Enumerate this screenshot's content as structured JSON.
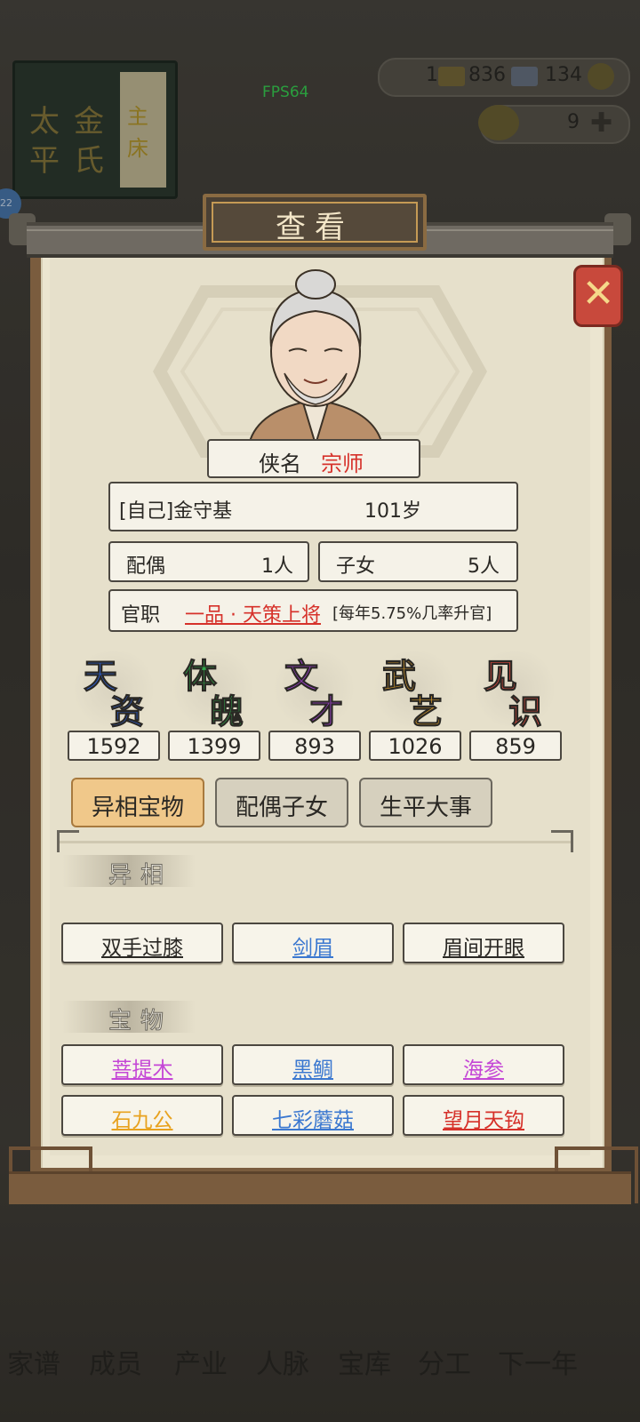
{
  "fps": "FPS64",
  "book_chars": [
    "太",
    "平",
    "金",
    "氏",
    "主",
    "床"
  ],
  "level_badge": "22",
  "resources": {
    "r1": "1",
    "r2": "836",
    "r3": "134",
    "r4": "9"
  },
  "bottom_nav": [
    "家谱",
    "成员",
    "产业",
    "人脉",
    "宝库",
    "分工",
    "下一年"
  ],
  "dialog": {
    "title": "查看",
    "close_icon": "close-icon",
    "nickname_label": "侠名",
    "nickname_value": "宗师",
    "name": "[自己]金守基",
    "age": "101岁",
    "spouse_label": "配偶",
    "spouse_value": "1人",
    "children_label": "子女",
    "children_value": "5人",
    "office_label": "官职",
    "office_value": "一品 · 天策上将",
    "office_note": "[每年5.75%几率升官]",
    "attributes": [
      {
        "c1": "天",
        "c2": "资",
        "value": "1592",
        "color": "#2c5fd6"
      },
      {
        "c1": "体",
        "c2": "魄",
        "value": "1399",
        "color": "#2fa84a"
      },
      {
        "c1": "文",
        "c2": "才",
        "value": "893",
        "color": "#9a3fc9"
      },
      {
        "c1": "武",
        "c2": "艺",
        "value": "1026",
        "color": "#e0a12b"
      },
      {
        "c1": "见",
        "c2": "识",
        "value": "859",
        "color": "#d9483d"
      }
    ],
    "tabs": [
      "异相宝物",
      "配偶子女",
      "生平大事"
    ],
    "section_traits": "异相",
    "traits": [
      {
        "label": "双手过膝",
        "color": "#2a2824"
      },
      {
        "label": "剑眉",
        "color": "#3b78d0"
      },
      {
        "label": "眉间开眼",
        "color": "#2a2824"
      }
    ],
    "section_treasures": "宝物",
    "treasures": [
      {
        "label": "菩提木",
        "color": "#c447d6"
      },
      {
        "label": "黑鲷",
        "color": "#3b78d0"
      },
      {
        "label": "海参",
        "color": "#c447d6"
      },
      {
        "label": "石九公",
        "color": "#e8a21f"
      },
      {
        "label": "七彩蘑菇",
        "color": "#3b78d0"
      },
      {
        "label": "望月天钩",
        "color": "#d6312a"
      }
    ]
  }
}
